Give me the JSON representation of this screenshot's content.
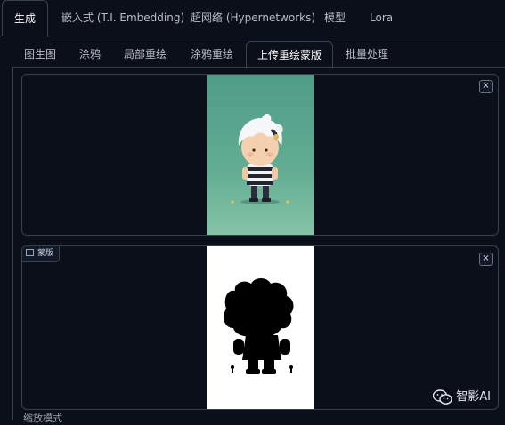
{
  "top_tabs": [
    "生成",
    "嵌入式 (T.I. Embedding)",
    "超网络 (Hypernetworks)",
    "模型",
    "Lora"
  ],
  "sub_tabs": [
    "图生图",
    "涂鸦",
    "局部重绘",
    "涂鸦重绘",
    "上传重绘蒙版",
    "批量处理"
  ],
  "image_panel": {
    "close": "×"
  },
  "mask_panel": {
    "label": "蒙版",
    "close": "×"
  },
  "bottom_text": "缩放模式",
  "watermark": "智影AI",
  "colors": {
    "background": "#0b0f19",
    "border": "#374151",
    "image_bg": "#5aa88e"
  }
}
